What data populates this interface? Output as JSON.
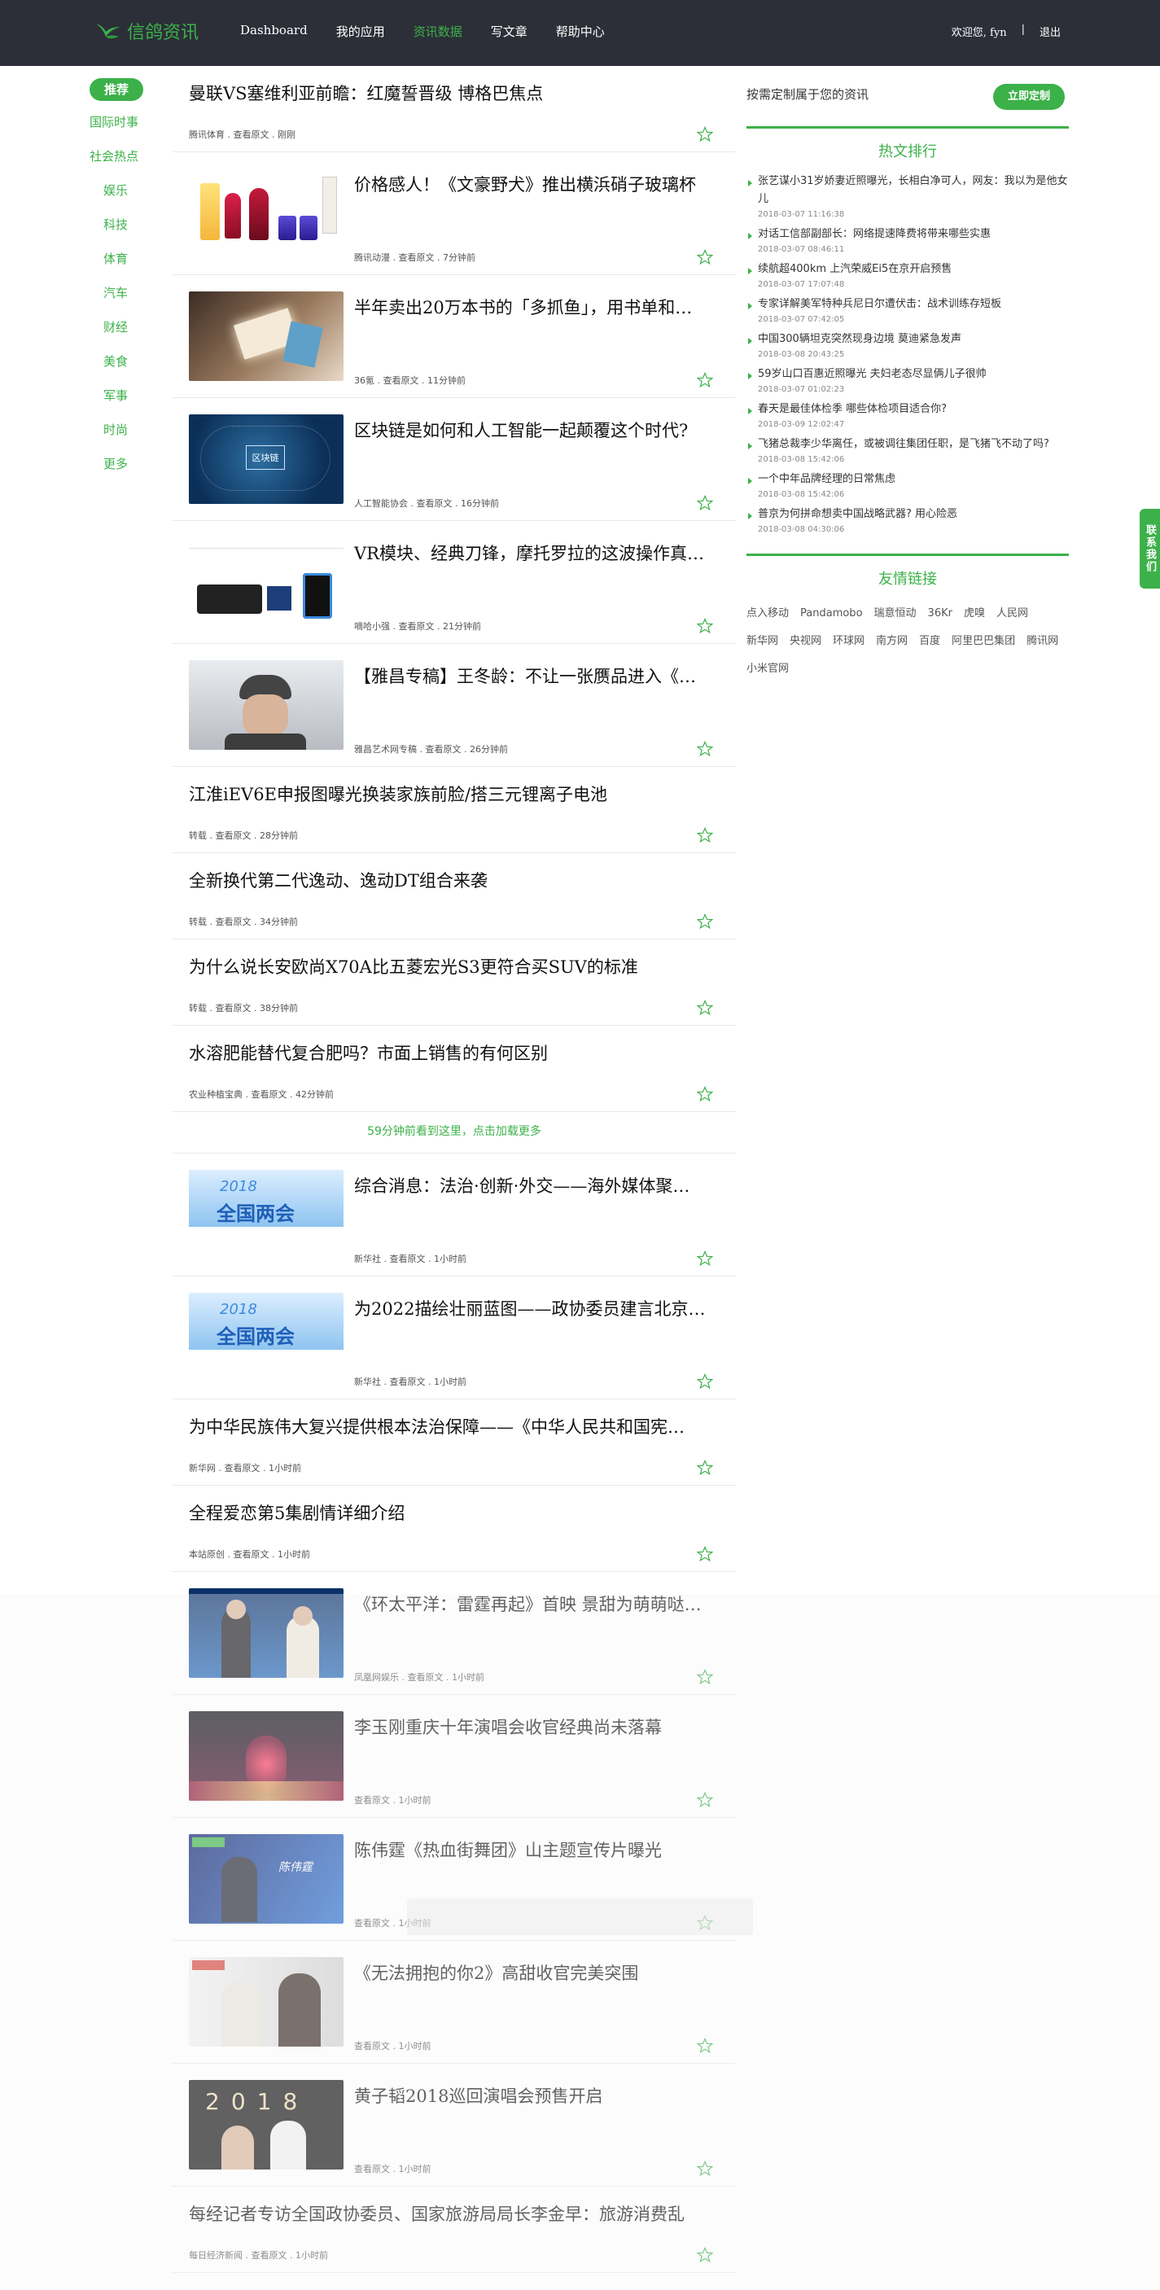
{
  "header": {
    "brand": "信鸽资讯",
    "nav": [
      {
        "label": "Dashboard",
        "active": false
      },
      {
        "label": "我的应用",
        "active": false
      },
      {
        "label": "资讯数据",
        "active": true
      },
      {
        "label": "写文章",
        "active": false
      },
      {
        "label": "帮助中心",
        "active": false
      }
    ],
    "welcome": "欢迎您,  fyn",
    "separator": "|",
    "logout": "退出"
  },
  "sidebar": {
    "items": [
      {
        "label": "推荐",
        "type": "recommend"
      },
      {
        "label": "国际时事",
        "type": "top"
      },
      {
        "label": "社会热点",
        "type": "top"
      },
      {
        "label": "娱乐",
        "type": "sub"
      },
      {
        "label": "科技",
        "type": "sub"
      },
      {
        "label": "体育",
        "type": "sub"
      },
      {
        "label": "汽车",
        "type": "sub"
      },
      {
        "label": "财经",
        "type": "sub"
      },
      {
        "label": "美食",
        "type": "sub"
      },
      {
        "label": "军事",
        "type": "sub"
      },
      {
        "label": "时尚",
        "type": "sub"
      },
      {
        "label": "更多",
        "type": "sub"
      }
    ]
  },
  "feed": {
    "articles": [
      {
        "title": "曼联VS塞维利亚前瞻：红魔誓晋级 博格巴焦点",
        "meta": "腾讯体育 . 查看原文 . 刚刚",
        "image": null
      },
      {
        "title": "价格感人！《文豪野犬》推出横浜硝子玻璃杯",
        "meta": "腾讯动漫 . 查看原文 . 7分钟前",
        "image": "glass-cups"
      },
      {
        "title": "半年卖出20万本书的「多抓鱼」，用书单和…",
        "meta": "36氪 . 查看原文 . 11分钟前",
        "image": "book-hands"
      },
      {
        "title": "区块链是如何和人工智能一起颠覆这个时代?",
        "meta": "人工智能协会 . 查看原文 . 16分钟前",
        "image": "blockchain-map"
      },
      {
        "title": "VR模块、经典刀锋，摩托罗拉的这波操作真…",
        "meta": "嘀哈小强 . 查看原文 . 21分钟前",
        "image": "vr-product"
      },
      {
        "title": "【雅昌专稿】王冬龄：不让一张赝品进入《…",
        "meta": "雅昌艺术网专稿 . 查看原文 . 26分钟前",
        "image": "elder-portrait"
      },
      {
        "title": "江淮iEV6E申报图曝光换装家族前脸/搭三元锂离子电池",
        "meta": "转载 . 查看原文 . 28分钟前",
        "image": null
      },
      {
        "title": "全新换代第二代逸动、逸动DT组合来袭",
        "meta": "转载 . 查看原文 . 34分钟前",
        "image": null
      },
      {
        "title": "为什么说长安欧尚X70A比五菱宏光S3更符合买SUV的标准",
        "meta": "转载 . 查看原文 . 38分钟前",
        "image": null
      },
      {
        "title": "水溶肥能替代复合肥吗？市面上销售的有何区别",
        "meta": "农业种植宝典 . 查看原文 . 42分钟前",
        "image": null
      }
    ],
    "load_more": "59分钟前看到这里，点击加载更多",
    "articles_more": [
      {
        "title": "综合消息：法治·创新·外交——海外媒体聚…",
        "meta": "新华社 . 查看原文 . 1小时前",
        "image": "lianghui-2018"
      },
      {
        "title": "为2022描绘壮丽蓝图——政协委员建言北京…",
        "meta": "新华社 . 查看原文 . 1小时前",
        "image": "lianghui-2018"
      },
      {
        "title": "为中华民族伟大复兴提供根本法治保障——《中华人民共和国宪…",
        "meta": "新华网 . 查看原文 . 1小时前",
        "image": null
      },
      {
        "title": "全程爱恋第5集剧情详细介绍",
        "meta": "本站原创 . 查看原文 . 1小时前",
        "image": null
      },
      {
        "title": "《环太平洋：雷霆再起》首映 景甜为萌萌哒…",
        "meta": "凤凰网娱乐 . 查看原文 . 1小时前",
        "image": "premiere"
      },
      {
        "title": "李玉刚重庆十年演唱会收官经典尚未落幕",
        "meta": "查看原文 . 1小时前",
        "image": "concert-red"
      },
      {
        "title": "陈伟霆《热血街舞团》山主题宣传片曝光",
        "meta": "查看原文 . 1小时前",
        "image": "dance-blue"
      },
      {
        "title": "《无法拥抱的你2》高甜收官完美突围",
        "meta": "查看原文 . 1小时前",
        "image": "drama-couple"
      },
      {
        "title": "黄子韬2018巡回演唱会预售开启",
        "meta": "查看原文 . 1小时前",
        "image": "tour-2018"
      },
      {
        "title": "每经记者专访全国政协委员、国家旅游局局长李金早：旅游消费乱",
        "meta": "每日经济新闻 . 查看原文 . 1小时前",
        "image": null
      }
    ]
  },
  "right": {
    "custom_text": "按需定制属于您的资讯",
    "custom_button": "立即定制",
    "hot_title": "热文排行",
    "hot": [
      {
        "title": "张艺谋小31岁娇妻近照曝光，长相白净可人，网友：我以为是他女儿",
        "time": "2018-03-07 11:16:38"
      },
      {
        "title": "对话工信部副部长：网络提速降费将带来哪些实惠",
        "time": "2018-03-07 08:46:11"
      },
      {
        "title": "续航超400km 上汽荣威Ei5在京开启预售",
        "time": "2018-03-07 17:07:48"
      },
      {
        "title": "专家详解美军特种兵尼日尔遭伏击：战术训练存短板",
        "time": "2018-03-07 07:42:05"
      },
      {
        "title": "中国300辆坦克突然现身边境 莫迪紧急发声",
        "time": "2018-03-08 20:43:25"
      },
      {
        "title": "59岁山口百惠近照曝光 夫妇老态尽显俩儿子很帅",
        "time": "2018-03-07 01:02:23"
      },
      {
        "title": "春天是最佳体检季 哪些体检项目适合你?",
        "time": "2018-03-09 12:02:47"
      },
      {
        "title": "飞猪总裁李少华离任，或被调往集团任职，是飞猪飞不动了吗?",
        "time": "2018-03-08 15:42:06"
      },
      {
        "title": "一个中年品牌经理的日常焦虑",
        "time": "2018-03-08 15:42:06"
      },
      {
        "title": "普京为何拼命想卖中国战略武器? 用心险恶",
        "time": "2018-03-08 04:30:06"
      }
    ],
    "links_title": "友情链接",
    "links": [
      "点入移动",
      "Pandamobo",
      "瑞意恒动",
      "36Kr",
      "虎嗅",
      "人民网",
      "新华网",
      "央视网",
      "环球网",
      "南方网",
      "百度",
      "阿里巴巴集团",
      "腾讯网",
      "小米官网"
    ]
  },
  "contact": "联系我们",
  "colors": {
    "accent": "#3cb14a",
    "topbar": "#2c2f38"
  }
}
